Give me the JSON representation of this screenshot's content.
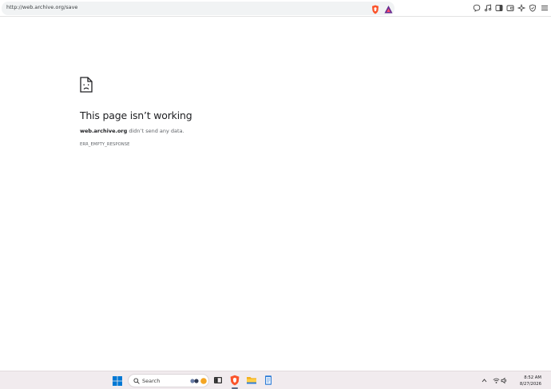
{
  "browser": {
    "url": "http://web.archive.org/save"
  },
  "error_page": {
    "title": "This page isn’t working",
    "host": "web.archive.org",
    "message": " didn’t send any data.",
    "code": "ERR_EMPTY_RESPONSE"
  },
  "taskbar": {
    "search_placeholder": "Search",
    "time": "8:52 AM",
    "date": "8/27/2026"
  },
  "colors": {
    "brave_orange": "#fb542b",
    "rewards_purple": "#662d91",
    "windows_blue": "#0078d4",
    "taskbar_bg": "#f1ebee"
  }
}
